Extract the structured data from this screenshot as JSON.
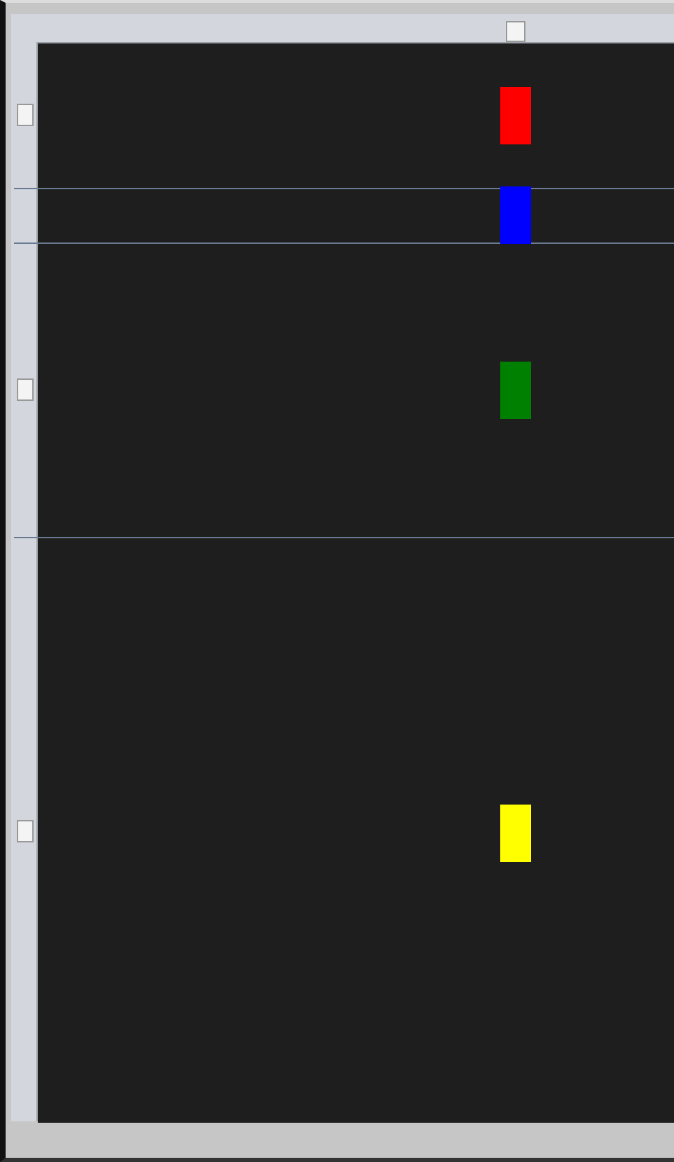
{
  "canvas": {
    "blocks": [
      {
        "color": "#ff0000"
      },
      {
        "color": "#0000ff"
      },
      {
        "color": "#008000"
      },
      {
        "color": "#ffff00"
      }
    ]
  }
}
